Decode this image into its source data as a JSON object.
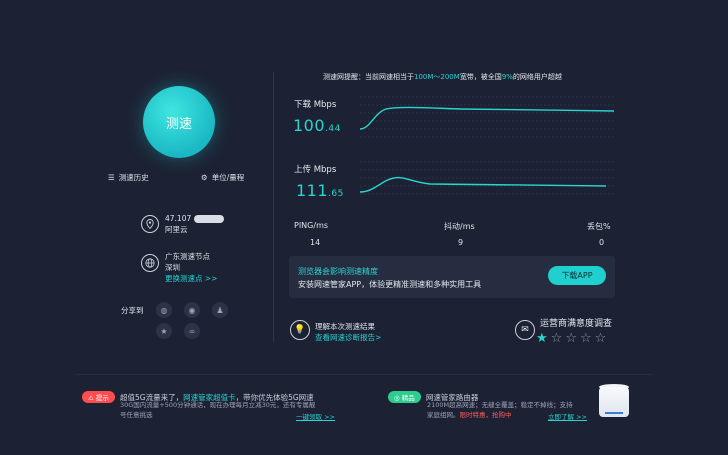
{
  "test": {
    "button_label": "测速"
  },
  "left": {
    "history_label": "测速历史",
    "units_label": "单位/量程",
    "ip": "47.107",
    "isp": "阿里云",
    "node_title": "广东测速节点",
    "node_city": "深圳",
    "change_node": "更换测速点 >>",
    "share_label": "分享到",
    "share_icons": [
      "wechat-icon",
      "weibo-icon",
      "qq-icon",
      "qzone-icon",
      "link-icon"
    ]
  },
  "notice": {
    "prefix": "测速网提醒：当前网速相当于",
    "range": "100M～200M",
    "middle": "宽带，被全国",
    "percent": "9%",
    "suffix": "的网络用户超越"
  },
  "download": {
    "label": "下载 Mbps",
    "int": "100",
    "dec": ".44"
  },
  "upload": {
    "label": "上传 Mbps",
    "int": "111",
    "dec": ".65"
  },
  "stats": {
    "ping_label": "PING/ms",
    "ping_val": "14",
    "jitter_label": "抖动/ms",
    "jitter_val": "9",
    "loss_label": "丢包%",
    "loss_val": "0"
  },
  "banner": {
    "title": "测览器会影响测速精度",
    "text": "安装网速管家APP，体验更精准测速和多种实用工具",
    "button": "下载APP"
  },
  "result": {
    "title": "理解本次测速结果",
    "link": "查看网速诊断报告>"
  },
  "survey": {
    "title": "运营商满意度调查",
    "rating": 1,
    "max": 5
  },
  "ads": {
    "left": {
      "tag": "提示",
      "title_a": "超值5G流量来了，",
      "title_b": "网速管家超值卡",
      "title_c": "，带你优先体验5G网速",
      "line1": "30G国内流量+500分钟通话，现在办理每月立减30元，还有专属靓",
      "line2": "号任意挑选",
      "link": "一键领取 >>"
    },
    "right": {
      "tag": "精品",
      "title": "网速管家路由器",
      "line1": "2100M超高网速；无缝全覆盖；稳定不掉线；支持",
      "line2a": "家庭组网。",
      "line2b": "限时特惠，抢购中",
      "link": "立即了解 >>"
    }
  },
  "colors": {
    "accent": "#2ad4d0",
    "background": "#1c2233",
    "warn": "#ff4d4f",
    "good": "#2ecc8f"
  }
}
